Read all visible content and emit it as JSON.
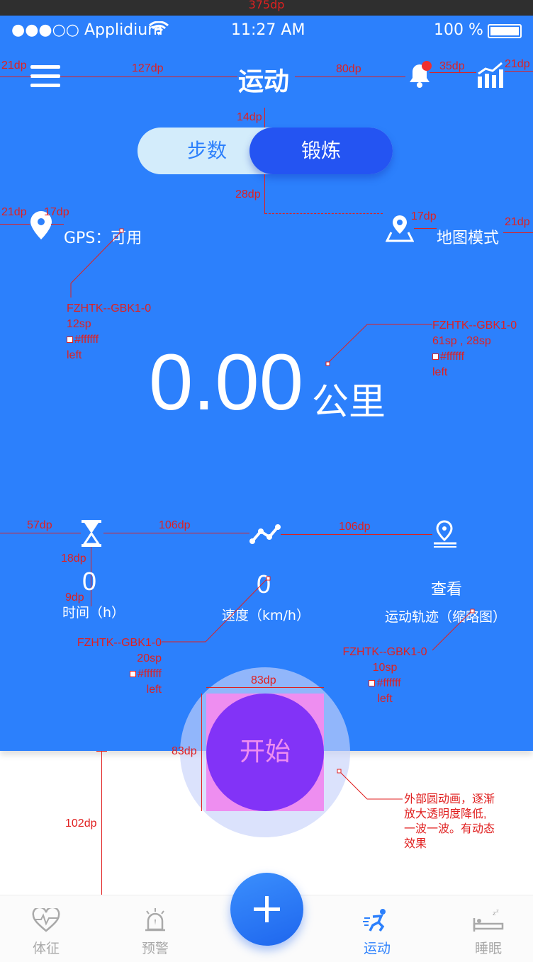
{
  "measurements": {
    "canvas_width": "375dp",
    "menu_margin": "21dp",
    "menu_to_title": "127dp",
    "title_to_bell": "80dp",
    "bell_to_chart": "35dp",
    "chart_margin": "21dp",
    "toggle_top_gap": "14dp",
    "toggle_bottom_gap": "28dp",
    "gps_margin": "21dp",
    "gps_icon_gap": "17dp",
    "map_icon_gap": "17dp",
    "map_margin": "21dp",
    "stats_left": "57dp",
    "stats_gap_1": "106dp",
    "stats_gap_2": "106dp",
    "icon_to_value": "18dp",
    "value_to_label": "9dp",
    "start_width": "83dp",
    "start_height": "83dp",
    "bottom_space": "102dp"
  },
  "status_bar": {
    "carrier": "●●●○○ Applidium",
    "time": "11:27 AM",
    "battery": "100 %"
  },
  "header": {
    "title": "运动",
    "menu_icon": "hamburger-menu-icon",
    "bell_icon": "bell-icon",
    "stats_icon": "trend-chart-icon",
    "badge_color": "#f03030"
  },
  "toggle": {
    "left_label": "步数",
    "right_label": "锻炼",
    "selected": "锻炼"
  },
  "gps": {
    "label": "GPS：可用",
    "map_mode": "地图模式"
  },
  "distance": {
    "value": "0.00",
    "unit": "公里"
  },
  "stats": [
    {
      "icon": "hourglass-icon",
      "value": "0",
      "label": "时间（h）"
    },
    {
      "icon": "speed-line-icon",
      "value": "0",
      "label": "速度（km/h）"
    },
    {
      "icon": "location-track-icon",
      "value": "查看",
      "label": "运动轨迹（缩略图）"
    }
  ],
  "start": {
    "label": "开始"
  },
  "annotations": {
    "gps_font": [
      "FZHTK--GBK1-0",
      "12sp",
      "#ffffff",
      "left"
    ],
    "distance_font": [
      "FZHTK--GBK1-0",
      "61sp , 28sp",
      "#ffffff",
      "left"
    ],
    "stat_value_font": [
      "FZHTK--GBK1-0",
      "20sp",
      "#ffffff",
      "left"
    ],
    "stat_label_font": [
      "FZHTK--GBK1-0",
      "10sp",
      "#ffffff",
      "left"
    ],
    "ripple_note": [
      "外部圆动画，逐渐",
      "放大透明度降低,",
      "一波一波。有动态",
      "效果"
    ]
  },
  "tabbar": {
    "items": [
      {
        "label": "体征",
        "icon": "heart-pulse-icon",
        "active": false
      },
      {
        "label": "预警",
        "icon": "alarm-light-icon",
        "active": false
      },
      {
        "label": "运动",
        "icon": "running-icon",
        "active": true
      },
      {
        "label": "睡眠",
        "icon": "sleep-bed-icon",
        "active": false
      }
    ],
    "fab_icon": "plus-icon"
  },
  "colors": {
    "primary": "#2c80fc",
    "toggle_active": "#2454f2",
    "start_button": "#8233f7",
    "annotation": "#e02020"
  }
}
